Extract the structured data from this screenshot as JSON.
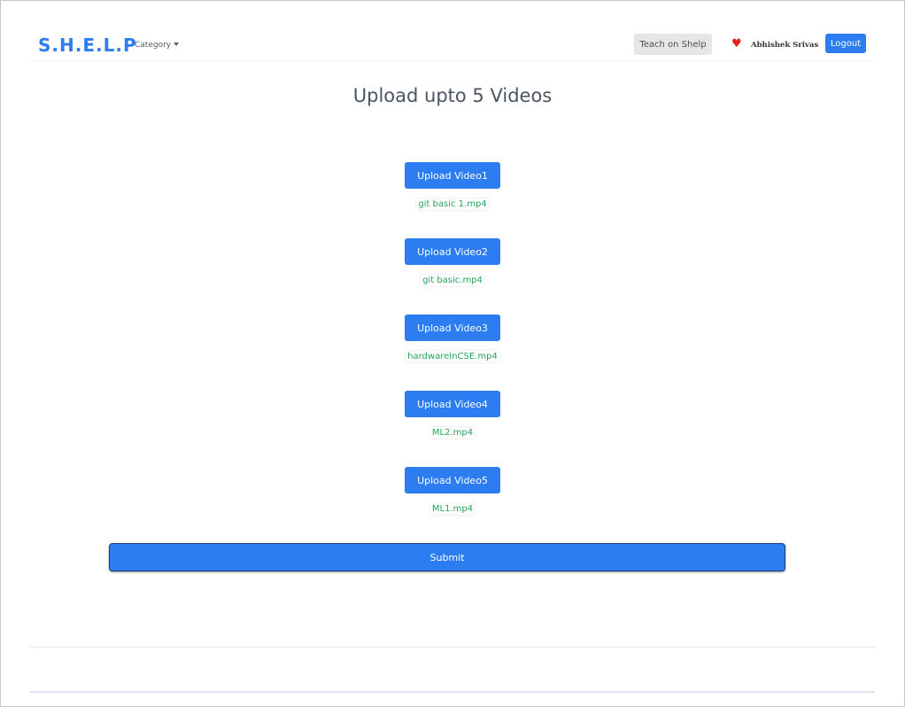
{
  "navbar": {
    "brand": "S.H.E.L.P",
    "category_label": "Category",
    "teach_label": "Teach on Shelp",
    "heart_icon": "heart-icon",
    "user_name": "Abhishek Srivas",
    "logout_label": "Logout",
    "accent_color": "#2b7df1"
  },
  "page": {
    "title": "Upload upto 5 Videos"
  },
  "uploads": [
    {
      "button_label": "Upload Video1",
      "file_name": "git basic 1.mp4"
    },
    {
      "button_label": "Upload Video2",
      "file_name": "git basic.mp4"
    },
    {
      "button_label": "Upload Video3",
      "file_name": "hardwareInCSE.mp4"
    },
    {
      "button_label": "Upload Video4",
      "file_name": "ML2.mp4"
    },
    {
      "button_label": "Upload Video5",
      "file_name": "ML1.mp4"
    }
  ],
  "form": {
    "submit_label": "Submit"
  }
}
